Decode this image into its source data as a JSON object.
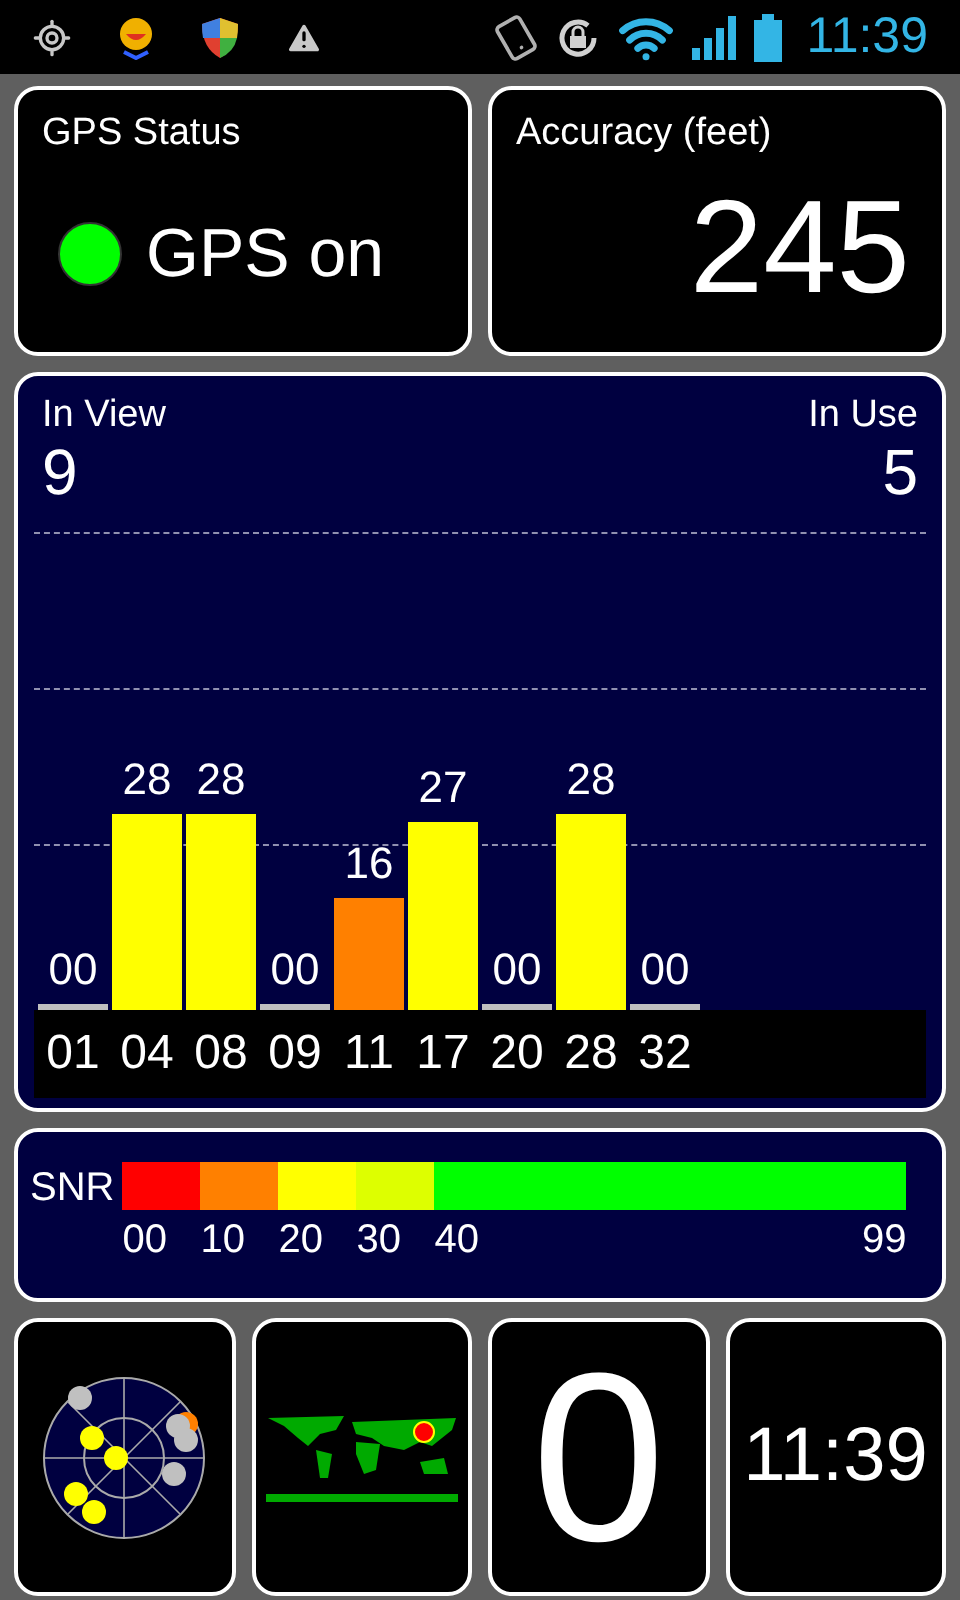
{
  "status_bar": {
    "time": "11:39"
  },
  "gps_status": {
    "title": "GPS Status",
    "on": true,
    "text": "GPS on"
  },
  "accuracy": {
    "title": "Accuracy (feet)",
    "value": "245"
  },
  "satellites": {
    "in_view_label": "In View",
    "in_view": "9",
    "in_use_label": "In Use",
    "in_use": "5",
    "bars": [
      {
        "id": "01",
        "snr": "00",
        "color": "#c0c0c0"
      },
      {
        "id": "04",
        "snr": "28",
        "color": "#ffff00"
      },
      {
        "id": "08",
        "snr": "28",
        "color": "#ffff00"
      },
      {
        "id": "09",
        "snr": "00",
        "color": "#c0c0c0"
      },
      {
        "id": "11",
        "snr": "16",
        "color": "#ff8000"
      },
      {
        "id": "17",
        "snr": "27",
        "color": "#ffff00"
      },
      {
        "id": "20",
        "snr": "00",
        "color": "#c0c0c0"
      },
      {
        "id": "28",
        "snr": "28",
        "color": "#ffff00"
      },
      {
        "id": "32",
        "snr": "00",
        "color": "#c0c0c0"
      }
    ]
  },
  "snr_legend": {
    "label": "SNR",
    "segments": [
      {
        "label": "00",
        "color": "#ff0000"
      },
      {
        "label": "10",
        "color": "#ff8000"
      },
      {
        "label": "20",
        "color": "#ffff00"
      },
      {
        "label": "30",
        "color": "#ddff00"
      },
      {
        "label": "40",
        "color": "#00ff00"
      }
    ],
    "end_label": "99"
  },
  "tiles": {
    "count": "0",
    "clock": "11:39"
  }
}
